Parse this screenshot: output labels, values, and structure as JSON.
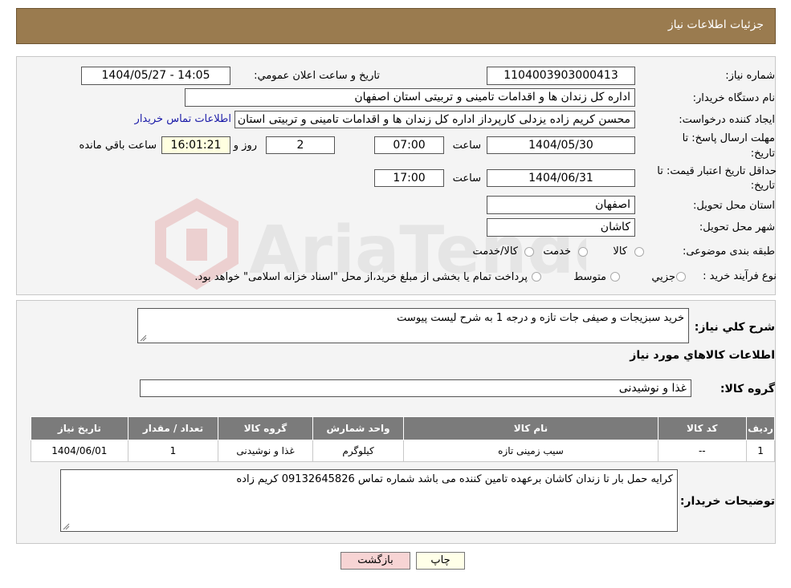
{
  "header": {
    "title": "جزئیات اطلاعات نیاز"
  },
  "form": {
    "need_number_label": "شماره نیاز:",
    "need_number": "1104003903000413",
    "announce_label": "تاريخ و ساعت اعلان عمومي:",
    "announce_value": "1404/05/27 - 14:05",
    "buyer_org_label": "نام دستگاه خريدار:",
    "buyer_org": "اداره کل زندان ها و اقدامات تامینی و تربیتی استان اصفهان",
    "creator_label": "ايجاد كننده درخواست:",
    "creator": "محسن کریم زاده یزدلی کارپرداز اداره کل زندان ها و اقدامات تامینی و تربیتی استان اصفهان",
    "contact_link": "اطلاعات تماس خريدار",
    "deadline_label_1": "مهلت ارسال پاسخ: تا",
    "deadline_label_2": "تاريخ:",
    "deadline_date": "1404/05/30",
    "time_label": "ساعت",
    "deadline_time": "07:00",
    "days_value": "2",
    "days_label": "روز و",
    "remaining_time": "16:01:21",
    "remaining_label": "ساعت باقي مانده",
    "validity_label_1": "حداقل تاريخ اعتبار قيمت: تا",
    "validity_label_2": "تاريخ:",
    "validity_date": "1404/06/31",
    "validity_time": "17:00",
    "province_label": "استان محل تحويل:",
    "province": "اصفهان",
    "city_label": "شهر محل تحويل:",
    "city": "کاشان",
    "category_label": "طبقه بندی موضوعی:",
    "category_options": [
      "کالا",
      "خدمت",
      "کالا/خدمت"
    ],
    "process_label": "نوع فرآيند خريد :",
    "process_options": [
      "جزیي",
      "متوسط"
    ],
    "process_note": "پرداخت تمام یا بخشی از مبلغ خرید،از محل \"اسناد خزانه اسلامی\" خواهد بود."
  },
  "details": {
    "summary_label": "شرح كلي نياز:",
    "summary": "خرید سبزیجات و صیفی جات تازه و  درجه 1 به شرح لیست پیوست",
    "goods_info_title": "اطلاعات كالاهاي مورد نياز",
    "goods_group_label": "گروه كالا:",
    "goods_group": "غذا و نوشیدنی",
    "table": {
      "headers": [
        "رديف",
        "كد كالا",
        "نام كالا",
        "واحد شمارش",
        "گروه كالا",
        "تعداد / مقدار",
        "تاريخ نياز"
      ],
      "rows": [
        [
          "1",
          "--",
          "سیب زمینی تازه",
          "کیلوگرم",
          "غذا و نوشیدنی",
          "1",
          "1404/06/01"
        ]
      ]
    },
    "buyer_notes_label": "توضيحات خريدار:",
    "buyer_notes": "کرایه حمل بار تا زندان کاشان برعهده تامین کننده می باشد  شماره تماس 09132645826 کریم زاده"
  },
  "buttons": {
    "print": "چاپ",
    "back": "بازگشت"
  },
  "colors": {
    "header_bg": "#9a7b4f",
    "table_header_bg": "#7b7b7b",
    "link": "#1a1aa8",
    "back_button_bg": "#f7d4d4",
    "print_button_bg": "#ffffe8"
  },
  "watermark": {
    "text": "AriaTender.neT"
  }
}
